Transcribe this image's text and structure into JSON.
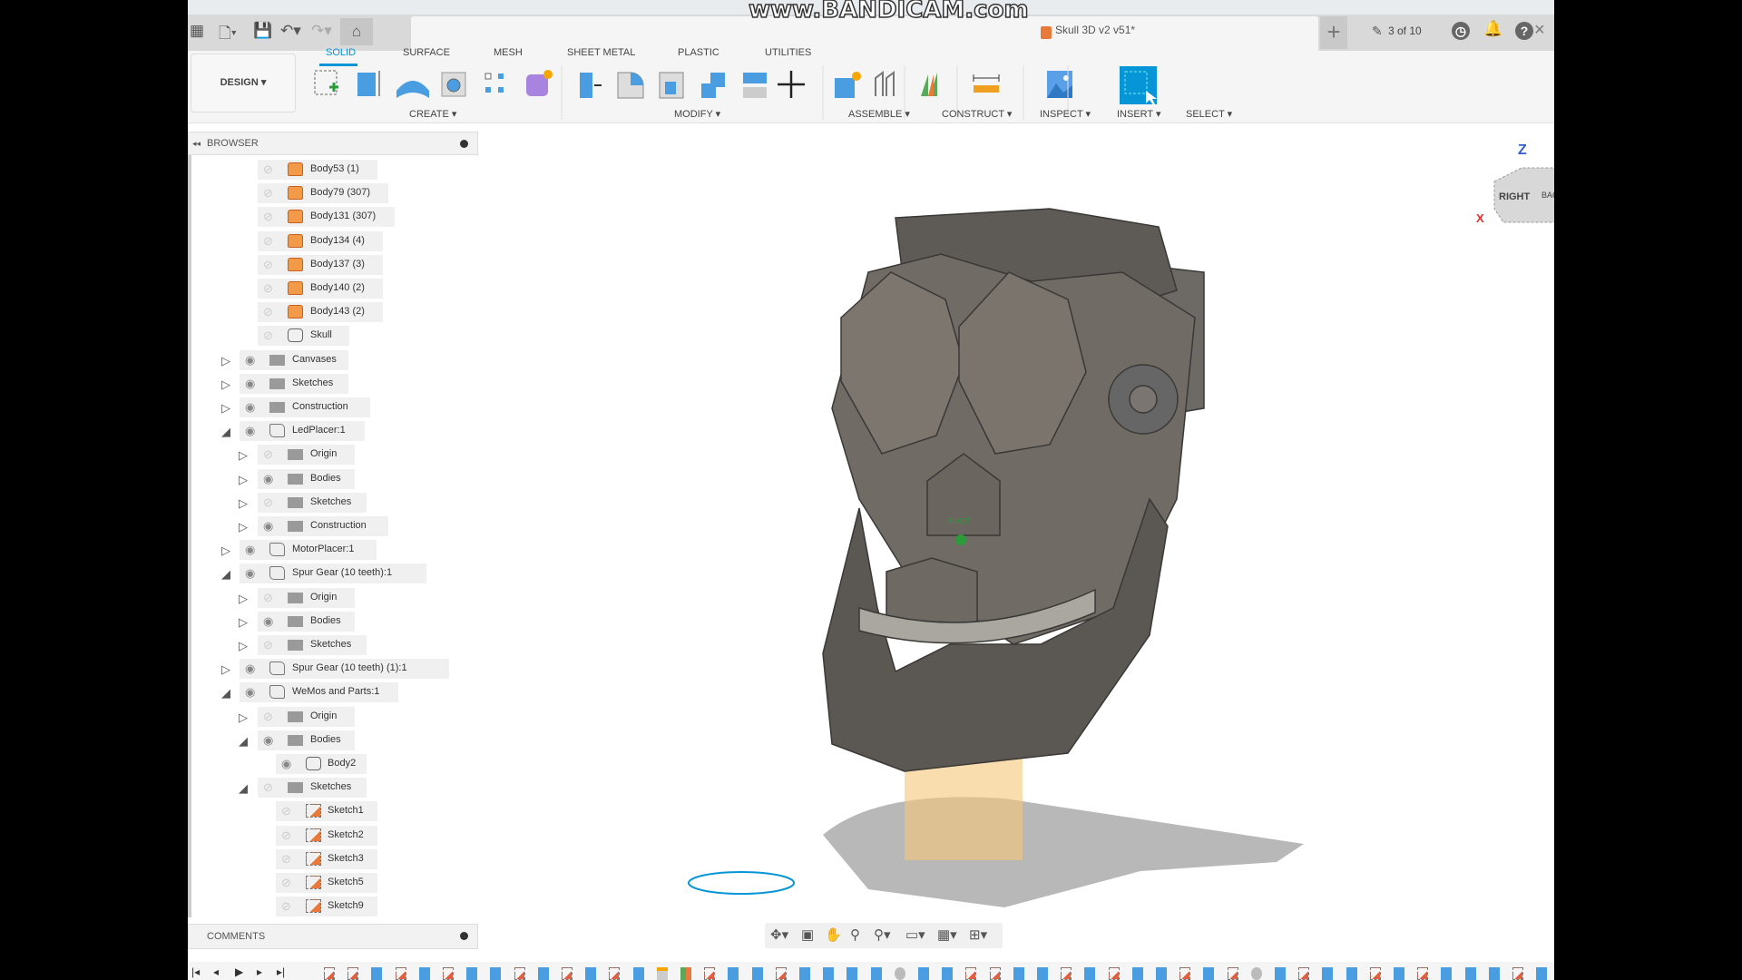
{
  "watermark": "www.BANDICAM.com",
  "document": {
    "title": "Skull 3D v2 v51*",
    "jobs": "3 of 10"
  },
  "ribbon": {
    "workspace": "DESIGN ▾",
    "tabs": [
      "SOLID",
      "SURFACE",
      "MESH",
      "SHEET METAL",
      "PLASTIC",
      "UTILITIES"
    ],
    "active_tab": "SOLID",
    "groups": [
      "CREATE ▾",
      "MODIFY ▾",
      "ASSEMBLE ▾",
      "CONSTRUCT ▾",
      "INSPECT ▾",
      "INSERT ▾",
      "SELECT ▾"
    ]
  },
  "browser": {
    "title": "BROWSER",
    "rows": [
      {
        "label": "Body53 (1)",
        "level": 2,
        "type": "body-orange",
        "expand": "none",
        "visible": false
      },
      {
        "label": "Body79 (307)",
        "level": 2,
        "type": "body-orange",
        "expand": "none",
        "visible": false
      },
      {
        "label": "Body131 (307)",
        "level": 2,
        "type": "body-orange",
        "expand": "none",
        "visible": false
      },
      {
        "label": "Body134 (4)",
        "level": 2,
        "type": "body-orange",
        "expand": "none",
        "visible": false
      },
      {
        "label": "Body137 (3)",
        "level": 2,
        "type": "body-orange",
        "expand": "none",
        "visible": false
      },
      {
        "label": "Body140 (2)",
        "level": 2,
        "type": "body-orange",
        "expand": "none",
        "visible": false
      },
      {
        "label": "Body143 (2)",
        "level": 2,
        "type": "body-orange",
        "expand": "none",
        "visible": false
      },
      {
        "label": "Skull",
        "level": 2,
        "type": "body",
        "expand": "none",
        "visible": false
      },
      {
        "label": "Canvases",
        "level": 1,
        "type": "folder",
        "expand": "collapsed",
        "visible": true
      },
      {
        "label": "Sketches",
        "level": 1,
        "type": "folder",
        "expand": "collapsed",
        "visible": true
      },
      {
        "label": "Construction",
        "level": 1,
        "type": "folder",
        "expand": "collapsed",
        "visible": true
      },
      {
        "label": "LedPlacer:1",
        "level": 1,
        "type": "component",
        "expand": "expanded",
        "visible": true
      },
      {
        "label": "Origin",
        "level": 2,
        "type": "folder",
        "expand": "collapsed",
        "visible": false
      },
      {
        "label": "Bodies",
        "level": 2,
        "type": "folder",
        "expand": "collapsed",
        "visible": true
      },
      {
        "label": "Sketches",
        "level": 2,
        "type": "folder",
        "expand": "collapsed",
        "visible": false
      },
      {
        "label": "Construction",
        "level": 2,
        "type": "folder",
        "expand": "collapsed",
        "visible": true
      },
      {
        "label": "MotorPlacer:1",
        "level": 1,
        "type": "component",
        "expand": "collapsed",
        "visible": true
      },
      {
        "label": "Spur Gear (10 teeth):1",
        "level": 1,
        "type": "component",
        "expand": "expanded",
        "visible": true
      },
      {
        "label": "Origin",
        "level": 2,
        "type": "folder",
        "expand": "collapsed",
        "visible": false
      },
      {
        "label": "Bodies",
        "level": 2,
        "type": "folder",
        "expand": "collapsed",
        "visible": true
      },
      {
        "label": "Sketches",
        "level": 2,
        "type": "folder",
        "expand": "collapsed",
        "visible": false
      },
      {
        "label": "Spur Gear (10 teeth) (1):1",
        "level": 1,
        "type": "component",
        "expand": "collapsed",
        "visible": true
      },
      {
        "label": "WeMos and Parts:1",
        "level": 1,
        "type": "component",
        "expand": "expanded",
        "visible": true
      },
      {
        "label": "Origin",
        "level": 2,
        "type": "folder",
        "expand": "collapsed",
        "visible": false
      },
      {
        "label": "Bodies",
        "level": 2,
        "type": "folder",
        "expand": "expanded",
        "visible": true
      },
      {
        "label": "Body2",
        "level": 3,
        "type": "body",
        "expand": "none",
        "visible": true
      },
      {
        "label": "Sketches",
        "level": 2,
        "type": "folder",
        "expand": "expanded",
        "visible": false
      },
      {
        "label": "Sketch1",
        "level": 3,
        "type": "sketch",
        "expand": "none",
        "visible": false
      },
      {
        "label": "Sketch2",
        "level": 3,
        "type": "sketch",
        "expand": "none",
        "visible": false
      },
      {
        "label": "Sketch3",
        "level": 3,
        "type": "sketch",
        "expand": "none",
        "visible": false
      },
      {
        "label": "Sketch5",
        "level": 3,
        "type": "sketch",
        "expand": "none",
        "visible": false
      },
      {
        "label": "Sketch9",
        "level": 3,
        "type": "sketch",
        "expand": "none",
        "visible": false
      }
    ]
  },
  "comments": {
    "title": "COMMENTS"
  },
  "viewcube": {
    "top": "Z",
    "front": "RIGHT",
    "side": "BACK",
    "axis_x": "X"
  },
  "viewport": {
    "pivot_label": "PIVOT"
  },
  "timeline": {
    "items": [
      "sketch",
      "sketch",
      "extrude",
      "sketch",
      "extrude",
      "sketch",
      "extrude",
      "extrude",
      "sketch",
      "extrude",
      "sketch",
      "extrude",
      "sketch",
      "extrude",
      "joint",
      "plane",
      "sketch",
      "extrude",
      "extrude",
      "sketch",
      "extrude",
      "extrude",
      "extrude",
      "extrude",
      "move",
      "extrude",
      "extrude",
      "sketch",
      "sketch",
      "extrude",
      "extrude",
      "sketch",
      "extrude",
      "sketch",
      "extrude",
      "extrude",
      "sketch",
      "extrude",
      "sketch",
      "move",
      "extrude",
      "sketch",
      "extrude",
      "extrude",
      "sketch",
      "extrude",
      "sketch",
      "extrude",
      "extrude",
      "extrude",
      "sketch",
      "extrude"
    ]
  },
  "colors": {
    "accent": "#0696d7",
    "orange": "#e8793a",
    "model": "#6b6660"
  }
}
